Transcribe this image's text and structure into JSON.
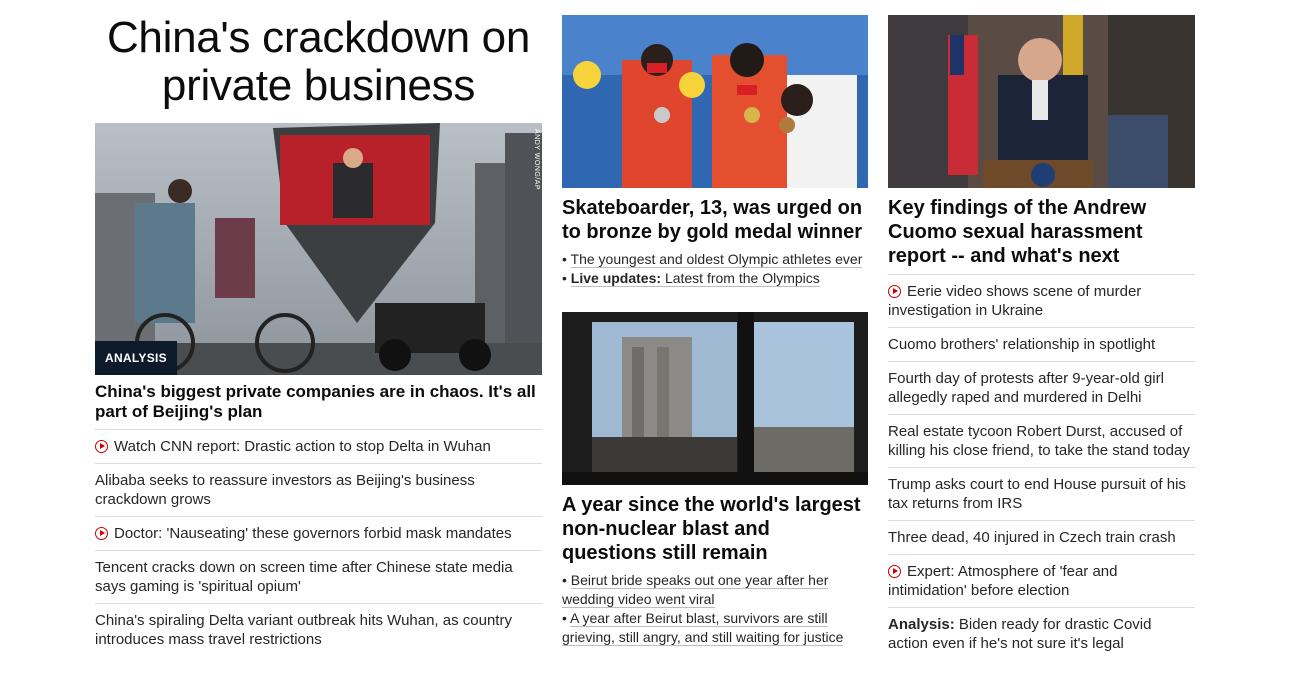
{
  "col1": {
    "banner": "China's crackdown on private business",
    "badge": "ANALYSIS",
    "credit": "ANDY WONG/AP",
    "headline": "China's biggest private companies are in chaos. It's all part of Beijing's plan",
    "items": [
      {
        "video": true,
        "text": "Watch CNN report: Drastic action to stop Delta in Wuhan"
      },
      {
        "video": false,
        "text": "Alibaba seeks to reassure investors as Beijing's business crackdown grows"
      },
      {
        "video": true,
        "text": "Doctor: 'Nauseating' these governors forbid mask mandates"
      },
      {
        "video": false,
        "text": "Tencent cracks down on screen time after Chinese state media says gaming is 'spiritual opium'"
      },
      {
        "video": false,
        "text": "China's spiraling Delta variant outbreak hits Wuhan, as country introduces mass travel restrictions"
      }
    ]
  },
  "col2": {
    "story1": {
      "headline": "Skateboarder, 13, was urged on to bronze by gold medal winner",
      "bullet1": "The youngest and oldest Olympic athletes ever",
      "bullet2_bold": "Live updates:",
      "bullet2": "Latest from the Olympics"
    },
    "story2": {
      "headline": "A year since the world's largest non-nuclear blast and questions still remain",
      "bullet1": "Beirut bride speaks out one year after her wedding video went viral",
      "bullet2": "A year after Beirut blast, survivors are still grieving, still angry, and still waiting for justice"
    }
  },
  "col3": {
    "headline": "Key findings of the Andrew Cuomo sexual harassment report -- and what's next",
    "items": [
      {
        "video": true,
        "bold": "",
        "text": "Eerie video shows scene of murder investigation in Ukraine"
      },
      {
        "video": false,
        "bold": "",
        "text": "Cuomo brothers' relationship in spotlight"
      },
      {
        "video": false,
        "bold": "",
        "text": "Fourth day of protests after 9-year-old girl allegedly raped and murdered in Delhi"
      },
      {
        "video": false,
        "bold": "",
        "text": "Real estate tycoon Robert Durst, accused of killing his close friend, to take the stand today"
      },
      {
        "video": false,
        "bold": "",
        "text": "Trump asks court to end House pursuit of his tax returns from IRS"
      },
      {
        "video": false,
        "bold": "",
        "text": "Three dead, 40 injured in Czech train crash"
      },
      {
        "video": true,
        "bold": "",
        "text": "Expert: Atmosphere of 'fear and intimidation' before election"
      },
      {
        "video": false,
        "bold": "Analysis:",
        "text": "Biden ready for drastic Covid action even if he's not sure it's legal"
      }
    ]
  },
  "colors": {
    "accent_red": "#cc0000",
    "text": "#262626",
    "divider": "#dcdcdc"
  }
}
